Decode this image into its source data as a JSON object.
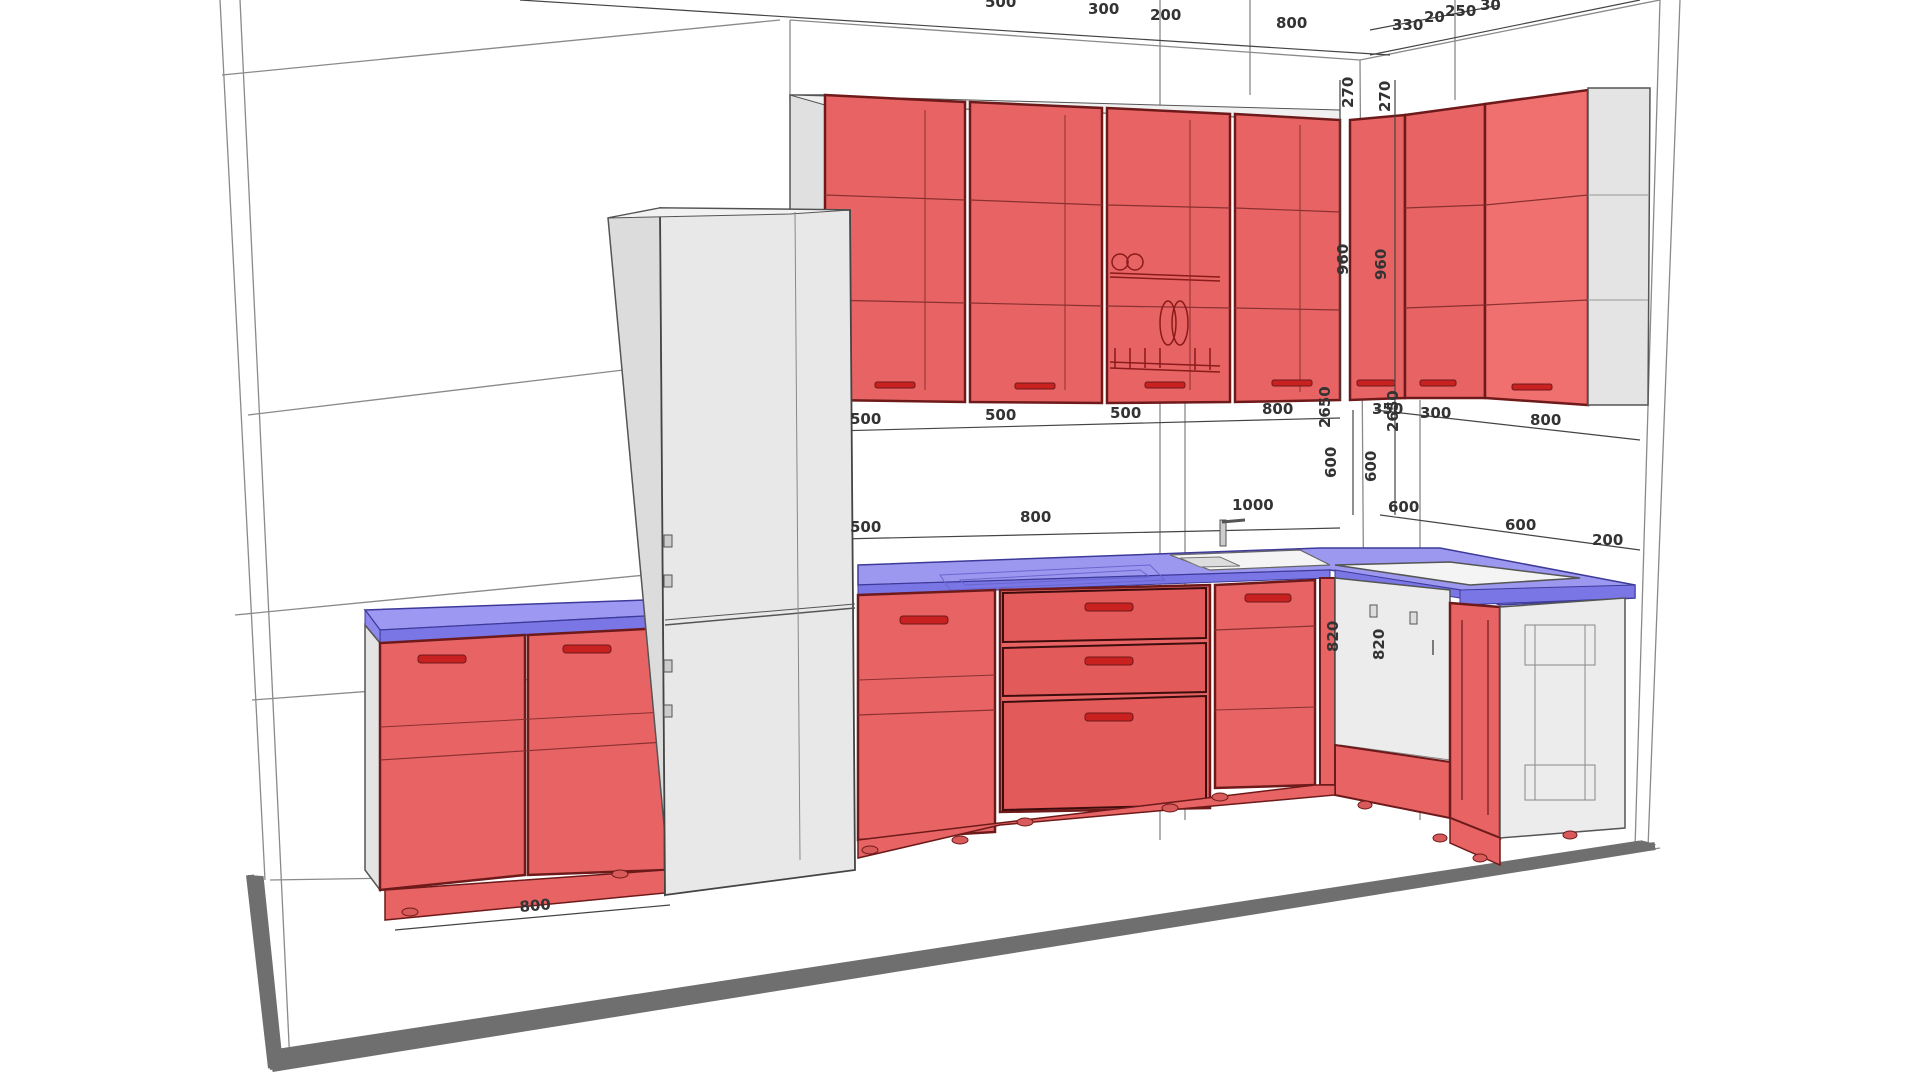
{
  "colors": {
    "cabinet_fill": "#e85c5c",
    "cabinet_edge": "#7a1c1c",
    "handle": "#c92020",
    "worktop_fill": "#8a87f0",
    "appliance_fill": "#e6e6e6",
    "appliance_edge": "#555555",
    "wall_line": "#888888",
    "floor_border": "#666666"
  },
  "dimensions": {
    "top_500": "500",
    "top_300": "300",
    "top_200": "200",
    "top_800": "800",
    "top_330": "330",
    "top_20": "20",
    "top_250": "250",
    "top_30": "30",
    "side_270_a": "270",
    "side_270_b": "270",
    "side_960_a": "960",
    "side_960_b": "960",
    "upper_500_a": "500",
    "upper_500_b": "500",
    "upper_500_c": "500",
    "upper_800": "800",
    "upper_2650_a": "2650",
    "upper_2650_b": "2650",
    "upper_350": "350",
    "upper_300": "300",
    "upper_800_r": "800",
    "side_600_a": "600",
    "side_600_b": "600",
    "lower_1000": "1000",
    "lower_600_a": "600",
    "lower_600_b": "600",
    "lower_200": "200",
    "lower_500": "500",
    "lower_800": "800",
    "side_820_a": "820",
    "side_820_b": "820",
    "floor_800": "800"
  }
}
